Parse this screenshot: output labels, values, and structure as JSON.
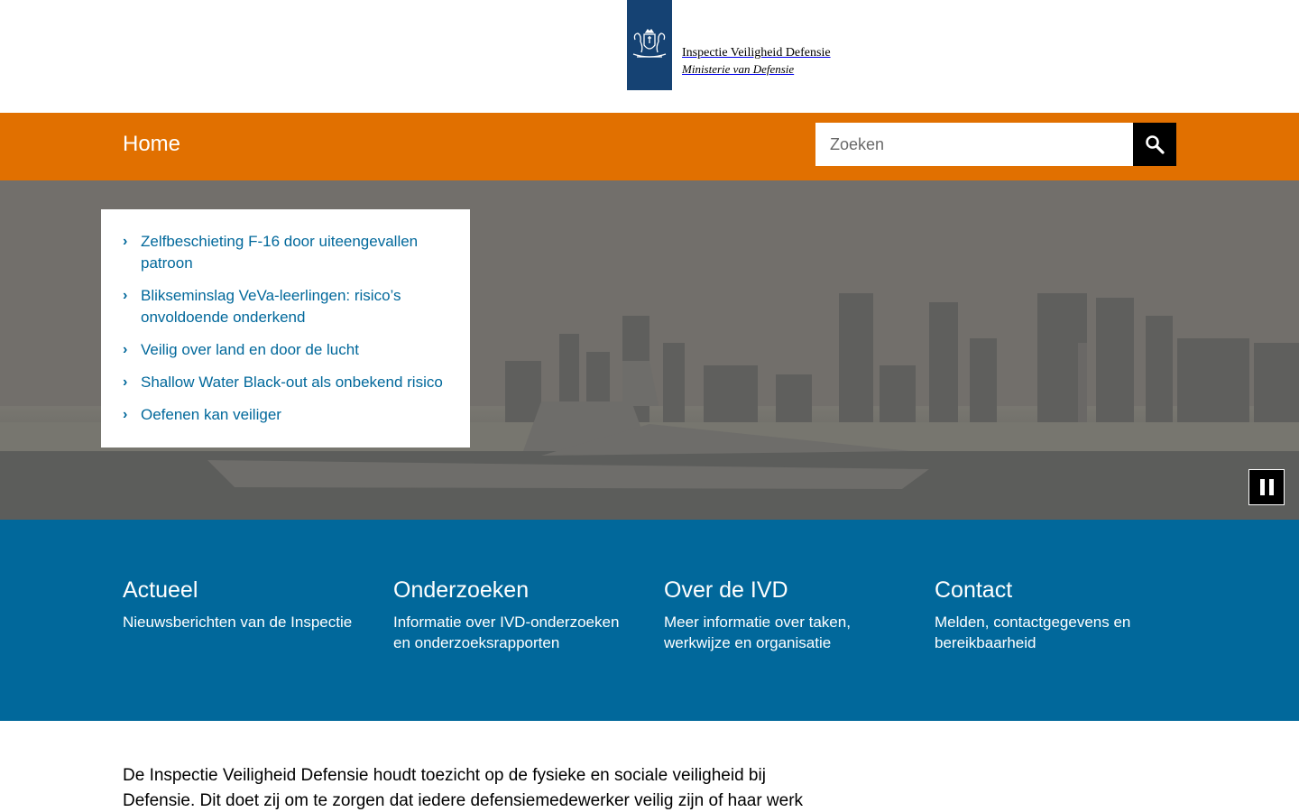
{
  "header": {
    "org_name": "Inspectie Veiligheid Defensie",
    "ministry": "Ministerie van Defensie",
    "logo_icon": "coat-of-arms-icon",
    "ribbon_color": "#154273"
  },
  "nav": {
    "home_label": "Home",
    "bar_color": "#e17000",
    "search": {
      "placeholder": "Zoeken",
      "value": "",
      "button_icon": "search-icon"
    }
  },
  "hero": {
    "items": [
      {
        "label": "Zelfbeschieting F-16 door uiteengevallen patroon"
      },
      {
        "label": "Blikseminslag VeVa-leerlingen: risico’s onvoldoende onderkend"
      },
      {
        "label": "Veilig over land en door de lucht"
      },
      {
        "label": "Shallow Water Black-out als onbekend risico"
      },
      {
        "label": "Oefenen kan veiliger"
      }
    ],
    "link_color": "#01689b",
    "pause_icon": "pause-icon"
  },
  "categories": [
    {
      "title": "Actueel",
      "description": "Nieuwsberichten van de Inspectie"
    },
    {
      "title": "Onderzoeken",
      "description": "Informatie over IVD-onderzoeken en onderzoeksrapporten"
    },
    {
      "title": "Over de IVD",
      "description": "Meer informatie over taken, werkwijze en organisatie"
    },
    {
      "title": "Contact",
      "description": "Melden, contactgegevens en bereikbaarheid"
    }
  ],
  "band_color": "#01689b",
  "intro": {
    "text": "De Inspectie Veiligheid Defensie houdt toezicht op de fysieke en sociale veiligheid bij Defensie. Dit doet zij om te zorgen dat iedere defensiemedewerker veilig zijn of haar werk"
  }
}
